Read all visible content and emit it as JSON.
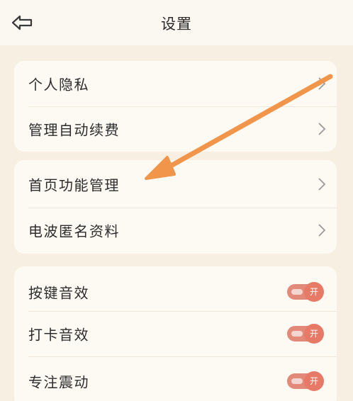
{
  "header": {
    "title": "设置",
    "back_icon": "back-arrow-icon"
  },
  "groups": [
    {
      "items": [
        {
          "label": "个人隐私",
          "type": "link"
        },
        {
          "label": "管理自动续费",
          "type": "link"
        }
      ]
    },
    {
      "items": [
        {
          "label": "首页功能管理",
          "type": "link"
        },
        {
          "label": "电波匿名资料",
          "type": "link"
        }
      ]
    },
    {
      "items": [
        {
          "label": "按键音效",
          "type": "toggle",
          "state": "开"
        },
        {
          "label": "打卡音效",
          "type": "toggle",
          "state": "开"
        },
        {
          "label": "专注震动",
          "type": "toggle",
          "state": "开"
        }
      ]
    }
  ],
  "colors": {
    "background": "#f6efe2",
    "card": "#fdfaf4",
    "toggle_on": "#e77a67",
    "annotation_arrow": "#f0954a"
  }
}
